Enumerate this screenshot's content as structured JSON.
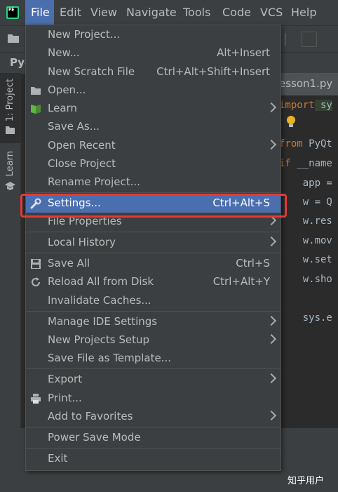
{
  "menubar": {
    "items": [
      "File",
      "Edit",
      "View",
      "Navigate",
      "Tools",
      "Code",
      "VCS",
      "Help"
    ],
    "active": "File"
  },
  "app_logo_text": "PE",
  "breadcrumb": {
    "project": "Pyc"
  },
  "side_tabs": {
    "project": "1: Project",
    "learn": "Learn"
  },
  "editor": {
    "tab_label": "esson1.py",
    "lines": [
      {
        "kw": "import",
        "rest": " sy"
      },
      {
        "kw": "from",
        "rest": " PyQt"
      },
      {
        "kw": "if",
        "rest": " __name"
      },
      {
        "kw": "",
        "rest": "    app ="
      },
      {
        "kw": "",
        "rest": "    w = Q"
      },
      {
        "kw": "",
        "rest": "    w.res"
      },
      {
        "kw": "",
        "rest": "    w.mov"
      },
      {
        "kw": "",
        "rest": "    w.set"
      },
      {
        "kw": "",
        "rest": "    w.sho"
      },
      {
        "kw": "",
        "rest": "    sys.e"
      }
    ]
  },
  "file_menu": {
    "items": [
      {
        "label": "New Project...",
        "shortcut": "",
        "submenu": false,
        "icon": ""
      },
      {
        "label": "New...",
        "shortcut": "Alt+Insert",
        "submenu": false,
        "icon": ""
      },
      {
        "label": "New Scratch File",
        "shortcut": "Ctrl+Alt+Shift+Insert",
        "submenu": false,
        "icon": ""
      },
      {
        "label": "Open...",
        "shortcut": "",
        "submenu": false,
        "icon": "folder-icon"
      },
      {
        "label": "Learn",
        "shortcut": "",
        "submenu": true,
        "icon": "book-icon"
      },
      {
        "label": "Save As...",
        "shortcut": "",
        "submenu": false,
        "icon": ""
      },
      {
        "label": "Open Recent",
        "shortcut": "",
        "submenu": true,
        "icon": ""
      },
      {
        "label": "Close Project",
        "shortcut": "",
        "submenu": false,
        "icon": ""
      },
      {
        "label": "Rename Project...",
        "shortcut": "",
        "submenu": false,
        "icon": ""
      },
      {
        "label": "Settings...",
        "shortcut": "Ctrl+Alt+S",
        "submenu": false,
        "icon": "wrench-icon",
        "selected": true
      },
      {
        "label": "File Properties",
        "shortcut": "",
        "submenu": true,
        "icon": ""
      },
      {
        "label": "Local History",
        "shortcut": "",
        "submenu": true,
        "icon": ""
      },
      {
        "label": "Save All",
        "shortcut": "Ctrl+S",
        "submenu": false,
        "icon": "floppy-icon"
      },
      {
        "label": "Reload All from Disk",
        "shortcut": "Ctrl+Alt+Y",
        "submenu": false,
        "icon": "reload-icon"
      },
      {
        "label": "Invalidate Caches...",
        "shortcut": "",
        "submenu": false,
        "icon": ""
      },
      {
        "label": "Manage IDE Settings",
        "shortcut": "",
        "submenu": true,
        "icon": ""
      },
      {
        "label": "New Projects Setup",
        "shortcut": "",
        "submenu": true,
        "icon": ""
      },
      {
        "label": "Save File as Template...",
        "shortcut": "",
        "submenu": false,
        "icon": ""
      },
      {
        "label": "Export",
        "shortcut": "",
        "submenu": true,
        "icon": ""
      },
      {
        "label": "Print...",
        "shortcut": "",
        "submenu": false,
        "icon": "printer-icon"
      },
      {
        "label": "Add to Favorites",
        "shortcut": "",
        "submenu": true,
        "icon": ""
      },
      {
        "label": "Power Save Mode",
        "shortcut": "",
        "submenu": false,
        "icon": ""
      },
      {
        "label": "Exit",
        "shortcut": "",
        "submenu": false,
        "icon": ""
      }
    ]
  },
  "watermark": "知乎用户",
  "colors": {
    "accent": "#4b6eaf",
    "highlight_box": "#e53935"
  }
}
